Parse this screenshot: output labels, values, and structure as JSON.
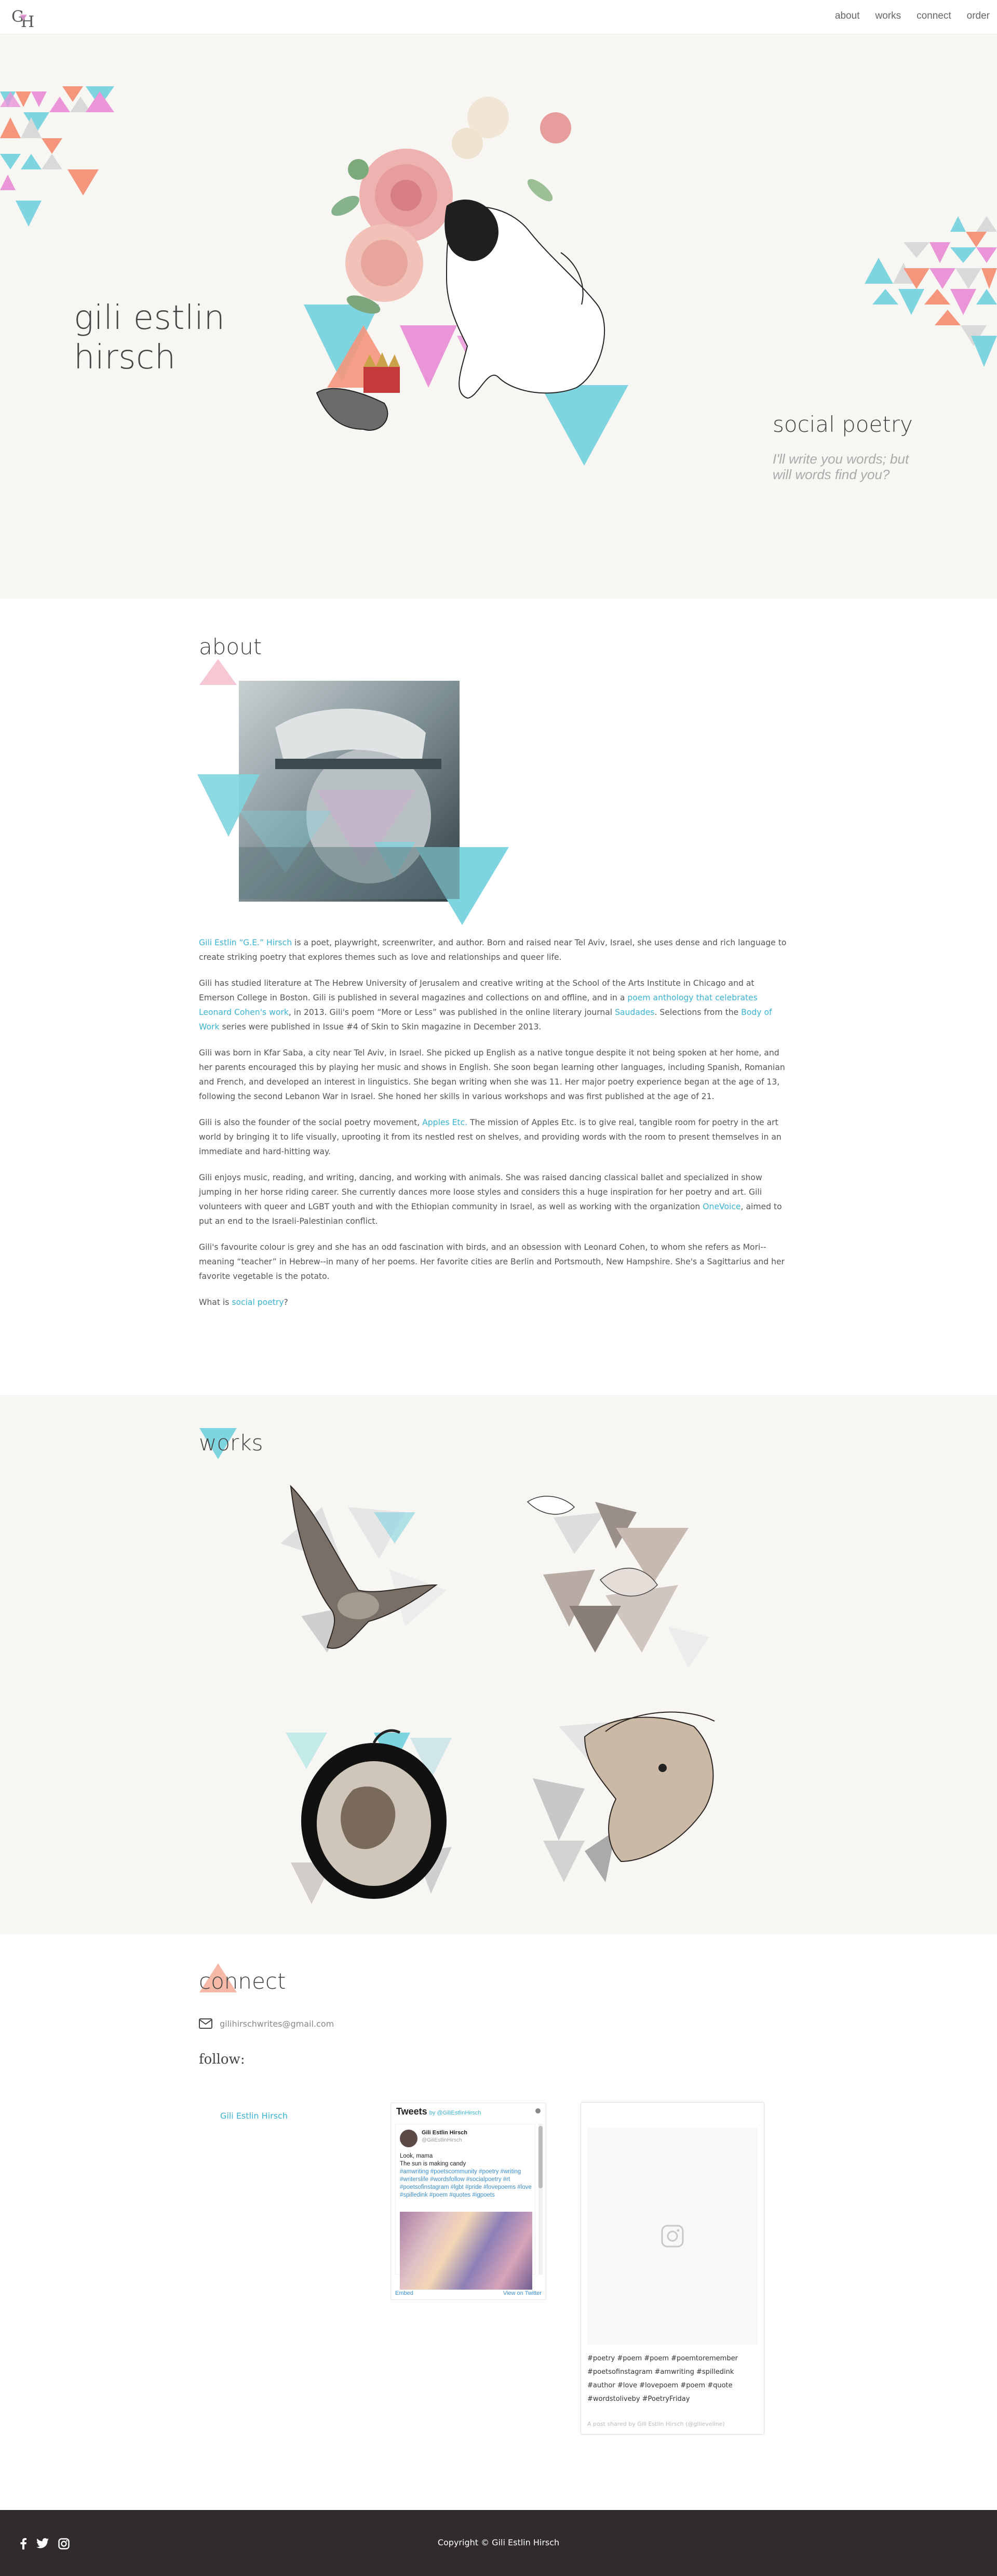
{
  "nav": {
    "logo": "GH",
    "links": [
      "about",
      "works",
      "connect",
      "order"
    ]
  },
  "hero": {
    "name_line1": "gili estlin",
    "name_line2": "hirsch",
    "tagline_title": "social poetry",
    "tagline_text": "I'll write you words; but will words find you?"
  },
  "about": {
    "title": "about",
    "p1_link": "Gili Estlin “G.E.” Hirsch",
    "p1_rest": " is a poet, playwright, screenwriter, and author. Born and raised near Tel Aviv, Israel, she uses dense and rich language to create striking poetry that explores themes such as love and relationships and queer life.",
    "p2_a": "Gili has studied literature at The Hebrew University of Jerusalem and creative writing at the School of the Arts Institute in Chicago and at Emerson College in Boston. Gili is published in several magazines and collections on and offline, and in a ",
    "p2_link1": "poem anthology that celebrates Leonard Cohen's work",
    "p2_b": ", in 2013. Gili's poem “More or Less” was published in the online literary journal ",
    "p2_link2": "Saudades",
    "p2_c": ". Selections from the ",
    "p2_link3": "Body of Work",
    "p2_d": " series were published in Issue #4 of Skin to Skin magazine in December 2013.",
    "p3": "Gili was born in Kfar Saba, a city near Tel Aviv, in Israel. She picked up English as a native tongue despite it not being spoken at her home, and her parents encouraged this by playing her music and shows in English. She soon began learning other languages, including Spanish, Romanian and French, and developed an interest in linguistics. She began writing when she was 11. Her major poetry experience began at the age of 13, following the second Lebanon War in Israel. She honed her skills in various workshops and was first published at the age of 21.",
    "p4_a": "Gili is also the founder of the social poetry movement, ",
    "p4_link": "Apples Etc.",
    "p4_b": " The mission of Apples Etc. is to give real, tangible room for poetry in the art world by bringing it to life visually, uprooting it from its nestled rest on shelves, and providing words with the room to present themselves in an immediate and hard-hitting way.",
    "p5_a": "Gili enjoys music, reading, and writing, dancing, and working with animals. She was raised dancing classical ballet and specialized in show jumping in her horse riding career. She currently dances more loose styles and considers this a huge inspiration for her poetry and art. Gili volunteers with queer and LGBT youth and with the Ethiopian community in Israel, as well as working with the organization ",
    "p5_link": "OneVoice",
    "p5_b": ", aimed to put an end to the Israeli-Palestinian conflict.",
    "p6": "Gili's favourite colour is grey and she has an odd fascination with birds, and an obsession with Leonard Cohen, to whom she refers as Mori--meaning “teacher” in Hebrew--in many of her poems. Her favorite cities are Berlin and Portsmouth, New Hampshire. She's a Sagittarius and her favorite vegetable is the potato.",
    "p7_a": "What is ",
    "p7_link": "social poetry",
    "p7_b": "?"
  },
  "works": {
    "title": "works"
  },
  "connect": {
    "title": "connect",
    "email": "gilihirschwrites@gmail.com",
    "follow_label": "follow:",
    "facebook_link": "Gili Estlin Hirsch",
    "twitter": {
      "header": "Tweets",
      "by": "by @GiliEstlinHirsch",
      "user": "Gili Estlin Hirsch",
      "handle": "@GiliEstlinHirsch",
      "text_a": "Look, mama",
      "text_b": "The sun is making candy",
      "hashtags": "#amwriting #poetscommunity #poetry #writing #writerslife #wordsfollow #socialpoetry #rt #poetsofinstagram #lgbt #pride #lovepoems #love #spilledink #poem #quotes #igpoets",
      "embed": "Embed",
      "view": "View on Twitter"
    },
    "instagram": {
      "caption": "#poetry #poem #poem #poemtoremember #poetsofinstagram #amwriting #spilledink #author #love #lovepoem #poem #quote #wordstoliveby #PoetryFriday",
      "credit": "A post shared by Gili Estlin Hirsch (@gilieveline)"
    }
  },
  "footer": {
    "copyright": "Copyright © Gili Estlin Hirsch"
  },
  "colors": {
    "teal": "#7fd5df",
    "pink": "#e995d8",
    "coral": "#f5957c",
    "grey": "#d9d9d9",
    "link": "#3bb3d3",
    "footer_bg": "#2f2c2b"
  }
}
